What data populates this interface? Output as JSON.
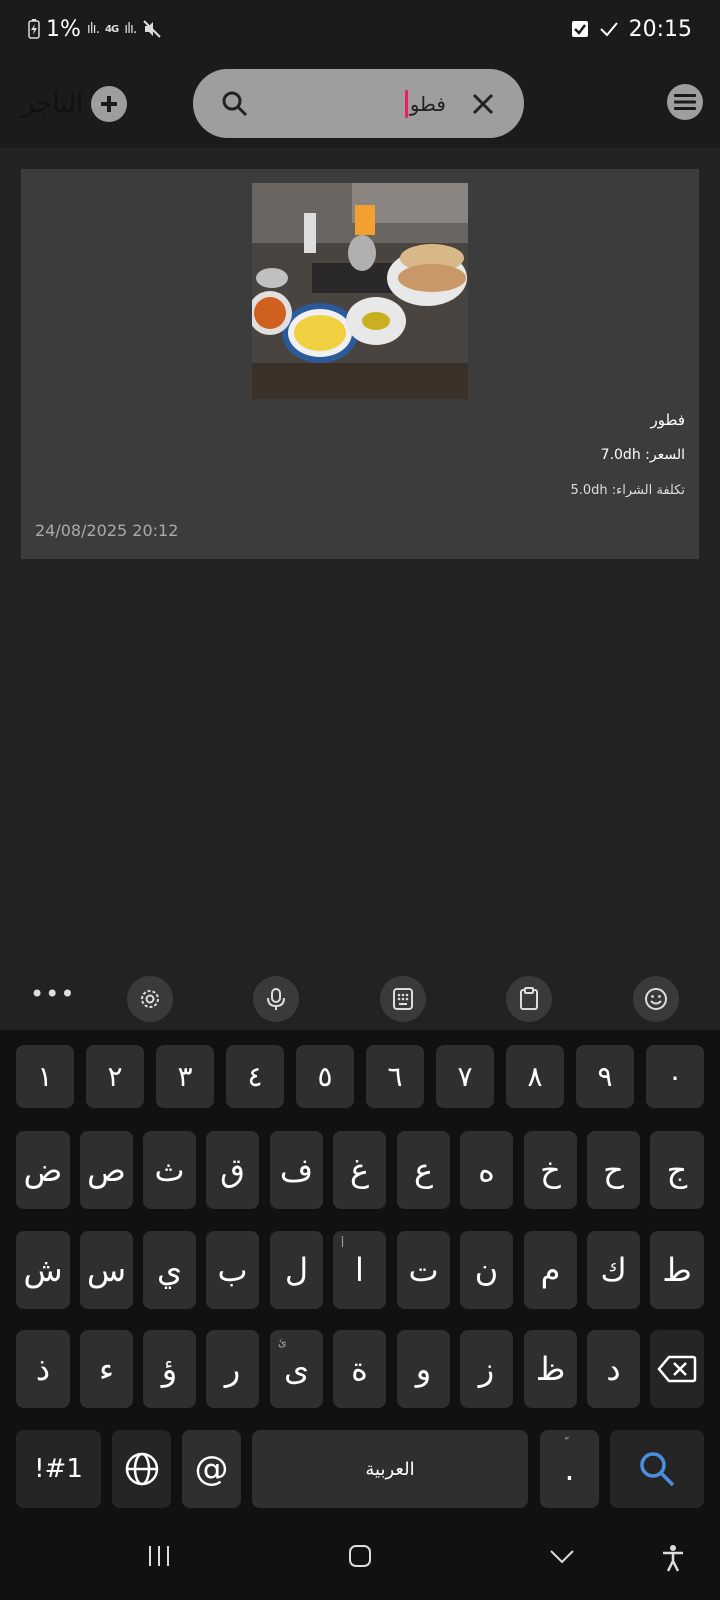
{
  "status_bar": {
    "battery": "1%",
    "network": "4G",
    "time": "20:15"
  },
  "app_bar": {
    "title": "التاجر",
    "search": {
      "query": "فطو"
    }
  },
  "item": {
    "name": "فطور",
    "price_label": "السعر:",
    "price_value": "7.0dh",
    "cost_label": "تكلفة الشراء:",
    "cost_value": "5.0dh",
    "date": "24/08/2025 20:12"
  },
  "keyboard": {
    "toolbar": [
      "more",
      "settings",
      "microphone",
      "keypad",
      "clipboard",
      "emoji"
    ],
    "digits": [
      "١",
      "٢",
      "٣",
      "٤",
      "٥",
      "٦",
      "٧",
      "٨",
      "٩",
      "٠"
    ],
    "row1": [
      "ض",
      "ص",
      "ث",
      "ق",
      "ف",
      "غ",
      "ع",
      "ه",
      "خ",
      "ح",
      "ج"
    ],
    "row2": [
      "ش",
      "س",
      "ي",
      "ب",
      "ل",
      "ا",
      "ت",
      "ن",
      "م",
      "ك",
      "ط"
    ],
    "row3": [
      "ذ",
      "ء",
      "ؤ",
      "ر",
      "ى",
      "ة",
      "و",
      "ز",
      "ظ",
      "د"
    ],
    "row3_hint": "ئ",
    "row2_hint": "أ",
    "symbols_label": "!#1",
    "space_label": "العربية",
    "period_label": ".",
    "period_hint": "ّ",
    "at_label": "@"
  },
  "colors": {
    "accent_search": "#4a90e2",
    "caret": "#e91e63"
  }
}
